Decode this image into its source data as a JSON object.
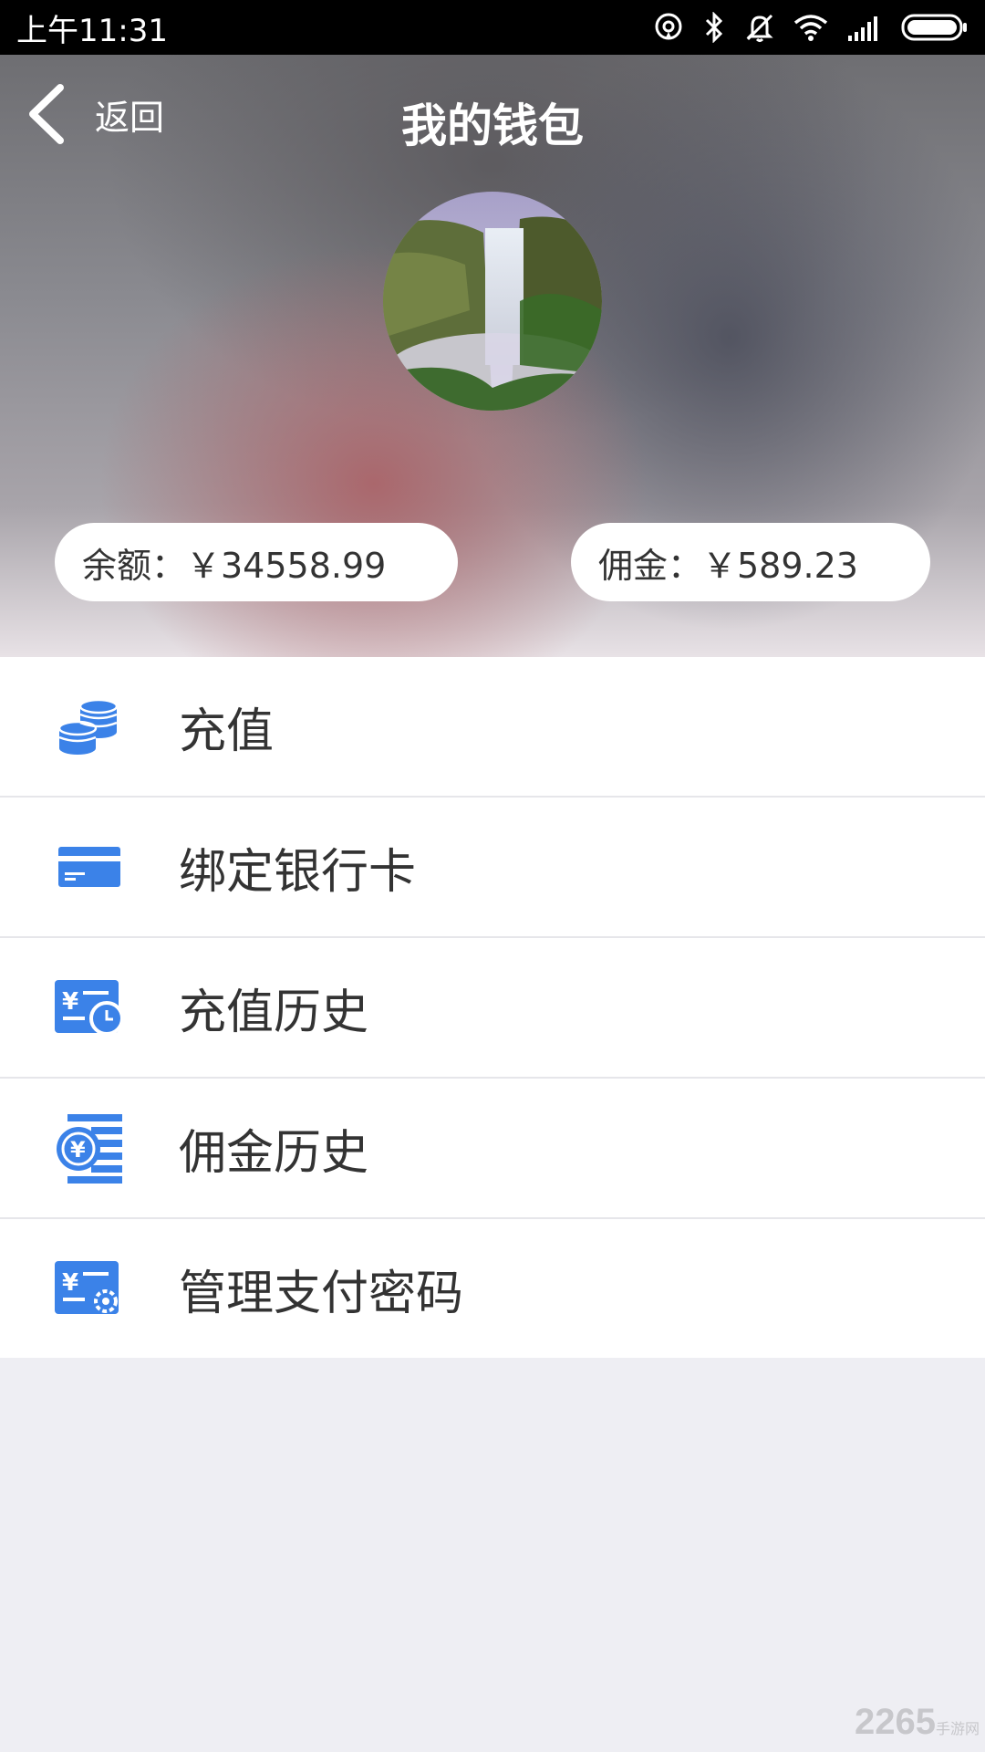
{
  "status_bar": {
    "time": "上午11:31",
    "icons": [
      "hotspot-icon",
      "bluetooth-icon",
      "mute-bell-icon",
      "wifi-icon",
      "signal-icon",
      "battery-icon"
    ]
  },
  "header": {
    "back_label": "返回",
    "title": "我的钱包",
    "balance": "余额：￥34558.99",
    "commission": "佣金：￥589.23"
  },
  "menu": {
    "items": [
      {
        "label": "充值",
        "icon": "coins-icon"
      },
      {
        "label": "绑定银行卡",
        "icon": "bank-card-icon"
      },
      {
        "label": "充值历史",
        "icon": "recharge-history-icon"
      },
      {
        "label": "佣金历史",
        "icon": "commission-history-icon"
      },
      {
        "label": "管理支付密码",
        "icon": "payment-password-icon"
      }
    ]
  },
  "watermark": {
    "main": "2265",
    "sub": "手游网"
  },
  "colors": {
    "accent": "#3b82e8",
    "background": "#eeeef3",
    "status_bar": "#000000"
  }
}
